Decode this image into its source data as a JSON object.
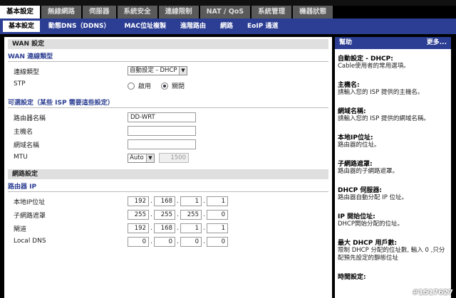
{
  "main_tabs": [
    "基本設定",
    "無線網路",
    "伺服器",
    "系統安全",
    "連線限制",
    "NAT / QoS",
    "系統管理",
    "機器狀態"
  ],
  "sub_tabs": [
    "基本設定",
    "動態DNS（DDNS）",
    "MAC位址複製",
    "進階路由",
    "網路",
    "EoIP 通道"
  ],
  "wan": {
    "section_title": "WAN 設定",
    "conn_legend": "WAN 連線類型",
    "conn_type_label": "連線類型",
    "conn_type_value": "自動設定 - DHCP",
    "stp_label": "STP",
    "stp_enable": "啟用",
    "stp_disable": "關閉"
  },
  "optional": {
    "legend": "可選設定（某些 ISP 需要這些設定）",
    "router_name_label": "路由器名稱",
    "router_name_value": "DD-WRT",
    "host_label": "主機名",
    "host_value": "",
    "domain_label": "網域名稱",
    "domain_value": "",
    "mtu_label": "MTU",
    "mtu_mode": "Auto",
    "mtu_value": "1500"
  },
  "network": {
    "section_title": "網路設定",
    "legend": "路由器 IP",
    "local_ip_label": "本地IP位址",
    "local_ip": [
      "192",
      "168",
      "1",
      "1"
    ],
    "mask_label": "子網路遮罩",
    "mask": [
      "255",
      "255",
      "255",
      "0"
    ],
    "gateway_label": "閘道",
    "gateway": [
      "192",
      "168",
      "1",
      "1"
    ],
    "dns_label": "Local DNS",
    "dns": [
      "0",
      "0",
      "0",
      "0"
    ]
  },
  "help": {
    "title": "幫助",
    "more": "更多...",
    "items": [
      {
        "title": "自動設定 - DHCP:",
        "desc": "Cable使用者的常用選項。"
      },
      {
        "title": "主機名:",
        "desc": "請輸入您的 ISP 提供的主機名。"
      },
      {
        "title": "網域名稱:",
        "desc": "請輸入您的 ISP 提供的網域名稱。"
      },
      {
        "title": "本地IP位址:",
        "desc": "路由器的位址。"
      },
      {
        "title": "子網路遮罩:",
        "desc": "路由器的子網路遮罩。"
      },
      {
        "title": "DHCP 伺服器:",
        "desc": "路由器自動分配 IP 位址。"
      },
      {
        "title": "IP 開始位址:",
        "desc": "DHCP開始分配的位址。"
      },
      {
        "title": "最大 DHCP 用戶數:",
        "desc": "限制 DHCP 分配的位址數, 輸入 0 ,只分配預先設定的靜態位址"
      },
      {
        "title": "時間設定:",
        "desc": ""
      }
    ]
  },
  "watermark": "#1517627"
}
